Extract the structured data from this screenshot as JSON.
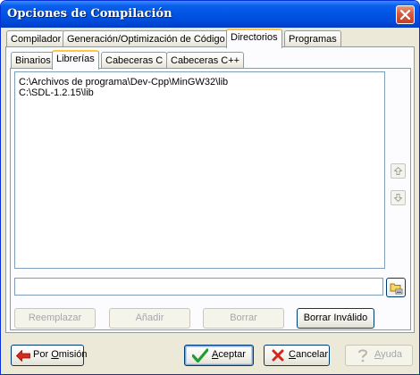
{
  "window": {
    "title": "Opciones de Compilación"
  },
  "main_tabs": [
    {
      "label": "Compilador",
      "active": false
    },
    {
      "label": "Generación/Optimización de Código",
      "active": false
    },
    {
      "label": "Directorios",
      "active": true
    },
    {
      "label": "Programas",
      "active": false
    }
  ],
  "sub_tabs": [
    {
      "label": "Binarios",
      "active": false
    },
    {
      "label": "Librerías",
      "active": true
    },
    {
      "label": "Cabeceras C",
      "active": false
    },
    {
      "label": "Cabeceras C++",
      "active": false
    }
  ],
  "directories": [
    "C:\\Archivos de programa\\Dev-Cpp\\MinGW32\\lib",
    "C:\\SDL-1.2.15\\lib"
  ],
  "path_input": {
    "value": ""
  },
  "actions": {
    "replace": "Reemplazar",
    "add": "Añadir",
    "delete": "Borrar",
    "delete_invalid": "Borrar Inválido"
  },
  "footer": {
    "default_prefix": "Por ",
    "default_accel": "O",
    "default_rest": "misión",
    "ok_accel": "A",
    "ok_rest": "ceptar",
    "cancel_accel": "C",
    "cancel_rest": "ancelar",
    "help_accel": "A",
    "help_rest": "yuda"
  },
  "icons": {
    "close": "close-x-icon",
    "up": "arrow-up-icon",
    "down": "arrow-down-icon",
    "browse": "folder-browse-icon",
    "default": "red-left-arrow-icon",
    "ok": "green-check-icon",
    "cancel": "red-x-icon",
    "help": "question-mark-icon"
  },
  "colors": {
    "titlebar": "#0054E3",
    "tab_highlight": "#FFC83C",
    "face": "#ECE9D8"
  }
}
